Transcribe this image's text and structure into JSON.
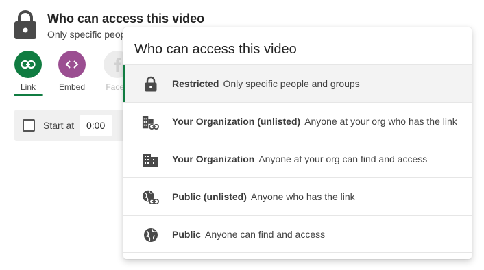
{
  "header": {
    "title": "Who can access this video",
    "subtitle": "Only specific peop"
  },
  "share_tabs": [
    {
      "label": "Link",
      "icon": "link-icon",
      "color": "#107c41"
    },
    {
      "label": "Embed",
      "icon": "code-icon",
      "color": "#9b4e91"
    },
    {
      "label": "Faceb",
      "icon": "facebook-icon",
      "color": "#ececec"
    }
  ],
  "options_bar": {
    "start_label": "Start at",
    "start_value": "0:00",
    "start_checked": false
  },
  "dropdown": {
    "title": "Who can access this video",
    "options": [
      {
        "name": "Restricted",
        "description": "Only specific people and groups",
        "icon": "lock-icon",
        "selected": true
      },
      {
        "name": "Your Organization (unlisted)",
        "description": "Anyone at your org who has the link",
        "icon": "building-link-icon",
        "selected": false
      },
      {
        "name": "Your Organization",
        "description": "Anyone at your org can find and access",
        "icon": "building-icon",
        "selected": false
      },
      {
        "name": "Public (unlisted)",
        "description": "Anyone who has the link",
        "icon": "globe-link-icon",
        "selected": false
      },
      {
        "name": "Public",
        "description": "Anyone can find and access",
        "icon": "globe-icon",
        "selected": false
      }
    ]
  },
  "colors": {
    "accent": "#107c41",
    "embed": "#9b4e91"
  }
}
